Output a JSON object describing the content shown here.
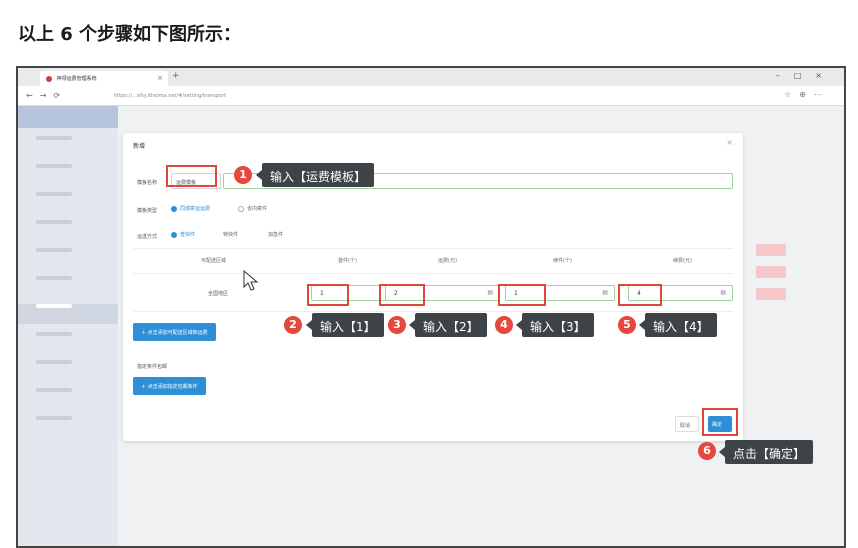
{
  "heading": "以上 6 个步骤如下图所示：",
  "browser": {
    "tab_title": "神领运费管理系统",
    "url": "https://...slhy.itheima.net/#/setting/transport"
  },
  "dialog": {
    "title": "新增",
    "close_icon": "close-icon",
    "template_name_label": "模板名称",
    "template_name_value": "运费模板",
    "template_type_label": "模板类型",
    "template_type_options": [
      "同城寄运运费",
      "省内寄件"
    ],
    "shipping_method_label": "运送方式",
    "shipping_method_options": [
      "普快件",
      "特快件",
      "加急件"
    ],
    "columns": [
      "可配送区域",
      "首件(个)",
      "运费(元)",
      "续件(个)",
      "续费(元)"
    ],
    "row_label": "全国地区",
    "values": [
      "1",
      "2",
      "1",
      "4"
    ],
    "unit_icon": "calendar-icon",
    "add_region_button": "点击添加可配送区域和运费",
    "specify_conditions_label": "指定条件包邮",
    "add_condition_button": "点击添加指定包邮条件",
    "cancel_label": "取消",
    "confirm_label": "确定"
  },
  "annotations": {
    "steps": [
      {
        "num": "1",
        "text": "输入【运费模板】"
      },
      {
        "num": "2",
        "text": "输入【1】"
      },
      {
        "num": "3",
        "text": "输入【2】"
      },
      {
        "num": "4",
        "text": "输入【3】"
      },
      {
        "num": "5",
        "text": "输入【4】"
      },
      {
        "num": "6",
        "text": "点击【确定】"
      }
    ]
  },
  "colors": {
    "accent": "#2c8fd8",
    "annotation_red": "#e0473c",
    "callout_bg": "#3d4347"
  }
}
